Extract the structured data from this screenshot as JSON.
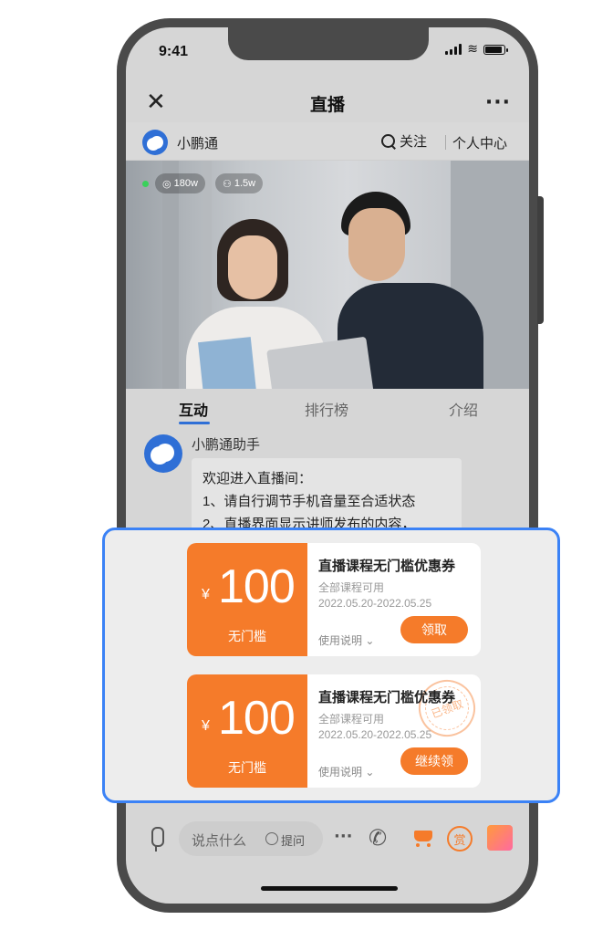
{
  "status": {
    "time": "9:41"
  },
  "nav": {
    "close_icon": "close-icon",
    "title": "直播",
    "more_icon": "more-icon"
  },
  "channel": {
    "name": "小鹏通",
    "follow_label": "关注",
    "user_center_label": "个人中心"
  },
  "video": {
    "views": "180w",
    "viewers": "1.5w"
  },
  "tabs": [
    {
      "label": "互动",
      "active": true
    },
    {
      "label": "排行榜",
      "active": false
    },
    {
      "label": "介绍",
      "active": false
    }
  ],
  "chat": {
    "sender": "小鹏通助手",
    "lines": [
      "欢迎进入直播间：",
      "1、请自行调节手机音量至合适状态",
      "2、直播界面显示讲师发布的内容，"
    ]
  },
  "coupons": [
    {
      "currency": "¥",
      "amount": "100",
      "threshold": "无门槛",
      "title": "直播课程无门槛优惠券",
      "subtitle": "全部课程可用",
      "date_range": "2022.05.20-2022.05.25",
      "usage_label": "使用说明 ⌄",
      "button_label": "领取",
      "stamp": ""
    },
    {
      "currency": "¥",
      "amount": "100",
      "threshold": "无门槛",
      "title": "直播课程无门槛优惠券",
      "subtitle": "全部课程可用",
      "date_range": "2022.05.20-2022.05.25",
      "usage_label": "使用说明 ⌄",
      "button_label": "继续领",
      "stamp": "已领取"
    }
  ],
  "bottom": {
    "input_placeholder": "说点什么",
    "ask_label": "提问",
    "reward_label": "赏"
  },
  "colors": {
    "accent_orange": "#f57b2a",
    "highlight_blue": "#3b82f6",
    "brand_blue": "#2f6fd6"
  }
}
